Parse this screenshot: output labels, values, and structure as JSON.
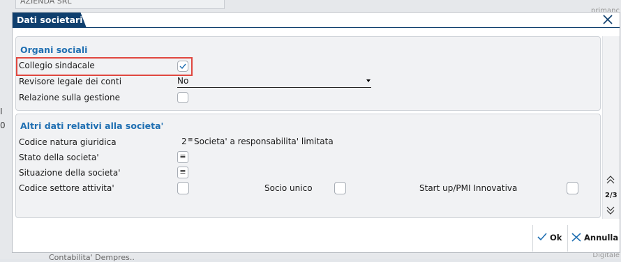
{
  "background": {
    "top_field_value": "AZIENDA SRL",
    "right_top_label": "primanc",
    "left_label_1": "I",
    "left_label_2": "0",
    "right_bottom_label": "Digitale",
    "bottom_label": "Contabilita' Dempres.."
  },
  "dialog": {
    "title": "Dati societari",
    "close_icon": "close-icon"
  },
  "organi_sociali": {
    "title": "Organi sociali",
    "collegio_label": "Collegio sindacale",
    "collegio_checked": true,
    "revisore_label": "Revisore legale dei conti",
    "revisore_value": "No",
    "relazione_label": "Relazione sulla gestione",
    "relazione_checked": false
  },
  "altri_dati": {
    "title": "Altri dati relativi alla societa'",
    "natura_label": "Codice natura giuridica",
    "natura_code": "2",
    "natura_desc": "Societa' a responsabilita' limitata",
    "stato_label": "Stato della societa'",
    "situazione_label": "Situazione della societa'",
    "settore_label": "Codice settore attivita'",
    "socio_label": "Socio unico",
    "startup_label": "Start up/PMI Innovativa"
  },
  "pager": {
    "page": "2/3"
  },
  "footer": {
    "ok_label": "Ok",
    "cancel_label": "Annulla"
  },
  "colors": {
    "title_bg": "#0f3f6e",
    "section_title": "#1f6fb2",
    "highlight": "#e0473f",
    "check_mark": "#1f6fb2"
  }
}
